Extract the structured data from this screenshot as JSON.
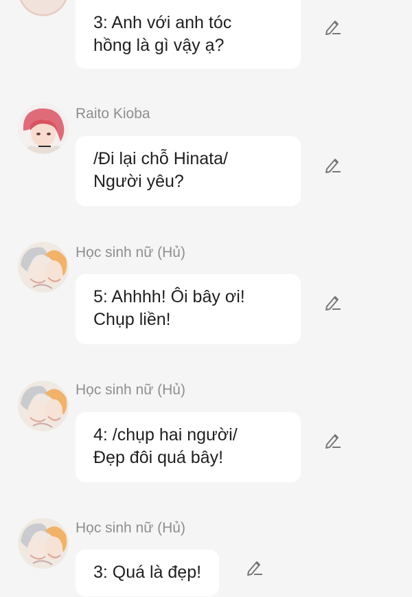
{
  "messages": [
    {
      "sender": "",
      "avatar": "faint-avatar-icon",
      "text": "3: Anh với anh tóc\nhồng là gì vậy ạ?"
    },
    {
      "sender": "Raito Kioba",
      "avatar": "pink-hair-boy-avatar-icon",
      "text": "/Đi lại chỗ Hinata/\nNgười yêu?"
    },
    {
      "sender": "Học sinh nữ (Hủ)",
      "avatar": "sketch-couple-avatar-icon",
      "text": "5: Ahhhh!  Ôi bây ơi!\nChụp liền!"
    },
    {
      "sender": "Học sinh nữ (Hủ)",
      "avatar": "sketch-couple-avatar-icon",
      "text": "4: /chụp hai người/\nĐẹp đôi quá bây!"
    },
    {
      "sender": "Học sinh nữ (Hủ)",
      "avatar": "sketch-couple-avatar-icon",
      "text": "3: Quá là đẹp!"
    }
  ],
  "colors": {
    "background": "#f5f5f5",
    "bubble": "#ffffff",
    "sender": "#8e8e8e",
    "text": "#1f1f1f",
    "edit_icon": "#777777"
  },
  "icons": {
    "edit": "pencil-edit-icon"
  }
}
